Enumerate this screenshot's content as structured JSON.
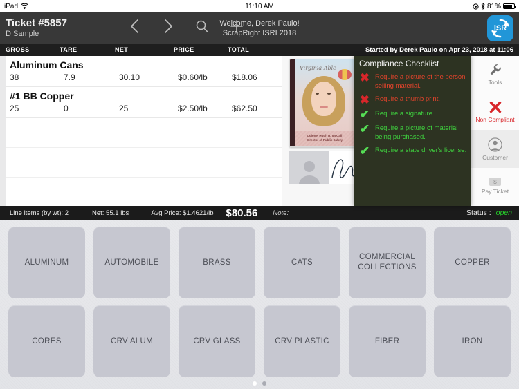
{
  "status_bar": {
    "carrier": "iPad",
    "wifi_icon": "wifi-icon",
    "time": "11:10 AM",
    "location_icon": "location-icon",
    "bluetooth_icon": "bluetooth-icon",
    "battery_percent": "81%"
  },
  "header": {
    "ticket_title": "Ticket #5857",
    "ticket_subtitle": "D Sample",
    "back_icon": "chevron-left-icon",
    "forward_icon": "chevron-right-icon",
    "search_icon": "search-icon",
    "add_icon": "plus-icon",
    "welcome_line1": "Welcome, Derek Paulo!",
    "welcome_line2": "ScrapRight ISRI 2018",
    "logo_text": "iSR",
    "logo_color": "#2196d8"
  },
  "ticket_table": {
    "columns": [
      "GROSS",
      "TARE",
      "NET",
      "PRICE",
      "TOTAL"
    ],
    "rows": [
      {
        "name": "Aluminum Cans",
        "gross": "38",
        "tare": "7.9",
        "net": "30.10",
        "price": "$0.60/lb",
        "total": "$18.06"
      },
      {
        "name": "#1 BB Copper",
        "gross": "25",
        "tare": "0",
        "net": "25",
        "price": "$2.50/lb",
        "total": "$62.50"
      }
    ]
  },
  "started_bar": {
    "text": "Started by Derek Paulo on Apr 23, 2018 at 11:06"
  },
  "documents": {
    "id_card_signature": "Virginia Able",
    "id_card_caption_line1": "Colonel Hugh R. McCall",
    "id_card_caption_line2": "Director of Public Safety",
    "avatar_icon": "person-placeholder-icon",
    "signature_icon": "signature-icon"
  },
  "compliance": {
    "title": "Compliance Checklist",
    "fail_color": "#e8442c",
    "pass_color": "#3fd33f",
    "items": [
      {
        "state": "fail",
        "mark": "✖",
        "text": "Require a picture of the person selling material."
      },
      {
        "state": "fail",
        "mark": "✖",
        "text": "Require a thumb print."
      },
      {
        "state": "pass",
        "mark": "✔",
        "text": "Require a signature."
      },
      {
        "state": "pass",
        "mark": "✔",
        "text": "Require a picture of material being purchased."
      },
      {
        "state": "pass",
        "mark": "✔",
        "text": "Require a state driver's license."
      }
    ]
  },
  "actions": [
    {
      "label": "Tools",
      "icon": "wrench-icon",
      "state": "normal"
    },
    {
      "label": "Non Compliant",
      "icon": "red-x-icon",
      "state": "danger"
    },
    {
      "label": "Customer",
      "icon": "person-icon",
      "state": "selected"
    },
    {
      "label": "Pay Ticket",
      "icon": "dollar-icon",
      "state": "normal"
    }
  ],
  "totals_bar": {
    "line_items": "Line items (by wt): 2",
    "net": "Net: 55.1 lbs",
    "avg_price": "Avg Price: $1.4621/lb",
    "grand_total": "$80.56",
    "note_label": "Note:",
    "status_label": "Status :",
    "status_value": "open",
    "status_color": "#25d32a"
  },
  "categories": [
    "ALUMINUM",
    "AUTOMOBILE",
    "BRASS",
    "CATS",
    "COMMERCIAL COLLECTIONS",
    "COPPER",
    "CORES",
    "CRV ALUM",
    "CRV GLASS",
    "CRV PLASTIC",
    "FIBER",
    "IRON"
  ],
  "pager": {
    "pages": 2,
    "active": 0
  }
}
